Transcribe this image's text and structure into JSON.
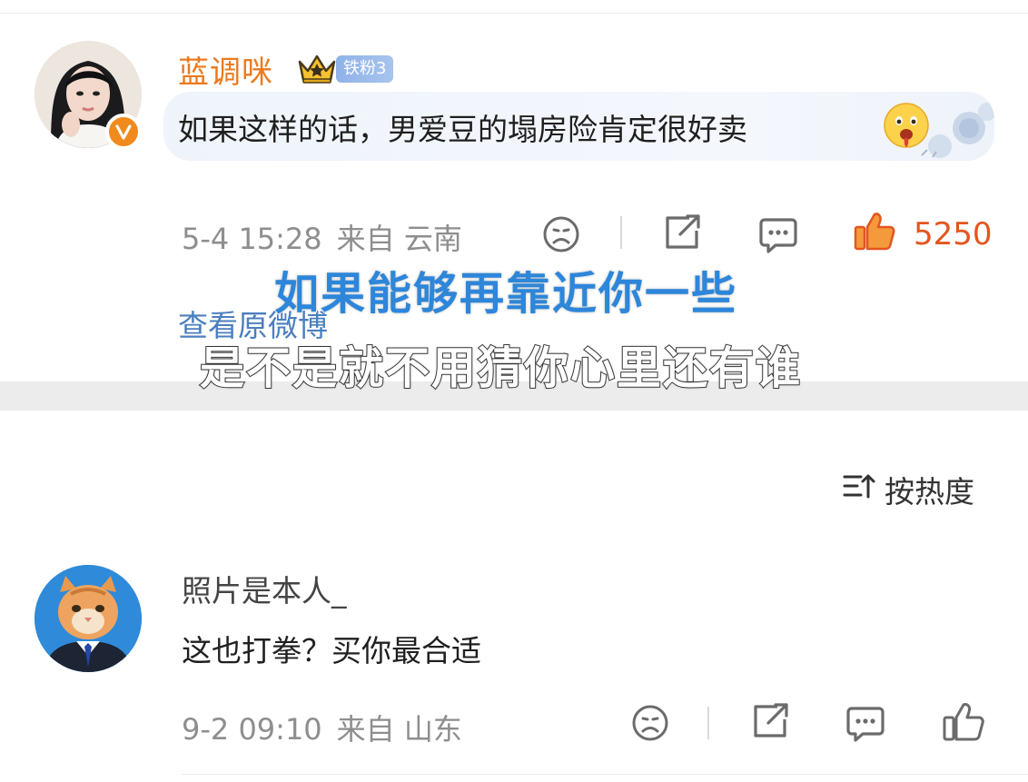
{
  "post1": {
    "username": "蓝调咪",
    "fan_badge": "铁粉3",
    "comment": "如果这样的话，男爱豆的塌房险肯定很好卖",
    "date": "5-4 15:28",
    "location": "来自 云南",
    "like_count": "5250",
    "view_original": "查看原微博"
  },
  "lyrics": {
    "line1": "如果能够再靠近你一些",
    "line2": "是不是就不用猜你心里还有谁"
  },
  "sort": {
    "label": "按热度"
  },
  "post2": {
    "username": "照片是本人_",
    "comment": "这也打拳？买你最合适",
    "date": "9-2 09:10",
    "location": "来自 山东"
  },
  "colors": {
    "username_orange": "#eb7a1e",
    "like_active": "#e3551f",
    "link_blue": "#4b7fbf",
    "lyric_blue": "#2d86d9",
    "fan_badge": "#9bbbe9"
  },
  "icons": {
    "verified": "verified-v-icon",
    "crown": "crown-icon",
    "dislike": "frown-face-icon",
    "share": "share-icon",
    "reply": "comment-bubble-icon",
    "like": "thumbs-up-icon",
    "sort": "sort-icon",
    "emoji": "drooling-face-emoji"
  }
}
